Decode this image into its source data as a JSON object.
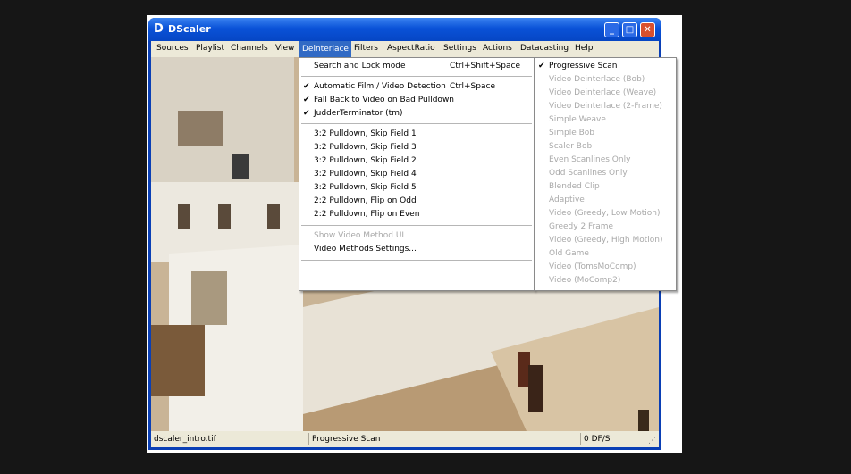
{
  "window": {
    "title": "DScaler"
  },
  "menubar": [
    "Sources",
    "Playlist",
    "Channels",
    "View",
    "Deinterlace",
    "Filters",
    "AspectRatio",
    "Settings",
    "Actions",
    "Datacasting",
    "Help"
  ],
  "deinterlace_menu": [
    {
      "label": "Search and Lock mode",
      "shortcut": "Ctrl+Shift+Space",
      "checked": false,
      "disabled": false
    },
    {
      "label": "Automatic Film / Video Detection",
      "shortcut": "Ctrl+Space",
      "checked": true,
      "disabled": false
    },
    {
      "label": "Fall Back to Video on Bad Pulldown",
      "shortcut": "",
      "checked": true,
      "disabled": false
    },
    {
      "label": "JudderTerminator (tm)",
      "shortcut": "",
      "checked": true,
      "disabled": false
    },
    {
      "label": "3:2 Pulldown, Skip Field 1",
      "shortcut": "",
      "checked": false,
      "disabled": false
    },
    {
      "label": "3:2 Pulldown, Skip Field 3",
      "shortcut": "",
      "checked": false,
      "disabled": false
    },
    {
      "label": "3:2 Pulldown, Skip Field 2",
      "shortcut": "",
      "checked": false,
      "disabled": false
    },
    {
      "label": "3:2 Pulldown, Skip Field 4",
      "shortcut": "",
      "checked": false,
      "disabled": false
    },
    {
      "label": "3:2 Pulldown, Skip Field 5",
      "shortcut": "",
      "checked": false,
      "disabled": false
    },
    {
      "label": "2:2 Pulldown, Flip on Odd",
      "shortcut": "",
      "checked": false,
      "disabled": false
    },
    {
      "label": "2:2 Pulldown, Flip on Even",
      "shortcut": "",
      "checked": false,
      "disabled": false
    },
    {
      "label": "Show Video Method UI",
      "shortcut": "",
      "checked": false,
      "disabled": true
    },
    {
      "label": "Video Methods Settings...",
      "shortcut": "",
      "checked": false,
      "disabled": false
    }
  ],
  "methods_menu": [
    {
      "label": "Progressive Scan",
      "checked": true,
      "disabled": false
    },
    {
      "label": "Video Deinterlace (Bob)",
      "checked": false,
      "disabled": true
    },
    {
      "label": "Video Deinterlace (Weave)",
      "checked": false,
      "disabled": true
    },
    {
      "label": "Video Deinterlace (2-Frame)",
      "checked": false,
      "disabled": true
    },
    {
      "label": "Simple Weave",
      "checked": false,
      "disabled": true
    },
    {
      "label": "Simple Bob",
      "checked": false,
      "disabled": true
    },
    {
      "label": "Scaler Bob",
      "checked": false,
      "disabled": true
    },
    {
      "label": "Even Scanlines Only",
      "checked": false,
      "disabled": true
    },
    {
      "label": "Odd Scanlines Only",
      "checked": false,
      "disabled": true
    },
    {
      "label": "Blended Clip",
      "checked": false,
      "disabled": true
    },
    {
      "label": "Adaptive",
      "checked": false,
      "disabled": true
    },
    {
      "label": "Video (Greedy, Low Motion)",
      "checked": false,
      "disabled": true
    },
    {
      "label": "Greedy 2 Frame",
      "checked": false,
      "disabled": true
    },
    {
      "label": "Video (Greedy, High Motion)",
      "checked": false,
      "disabled": true
    },
    {
      "label": "Old Game",
      "checked": false,
      "disabled": true
    },
    {
      "label": "Video (TomsMoComp)",
      "checked": false,
      "disabled": true
    },
    {
      "label": "Video (MoComp2)",
      "checked": false,
      "disabled": true
    }
  ],
  "status": {
    "file": "dscaler_intro.tif",
    "method": "Progressive Scan",
    "rate": "0 DF/S"
  },
  "colors": {
    "titlebar": "#0a52d8",
    "menu_highlight": "#316ac5",
    "disabled_text": "#a9a9a9"
  }
}
